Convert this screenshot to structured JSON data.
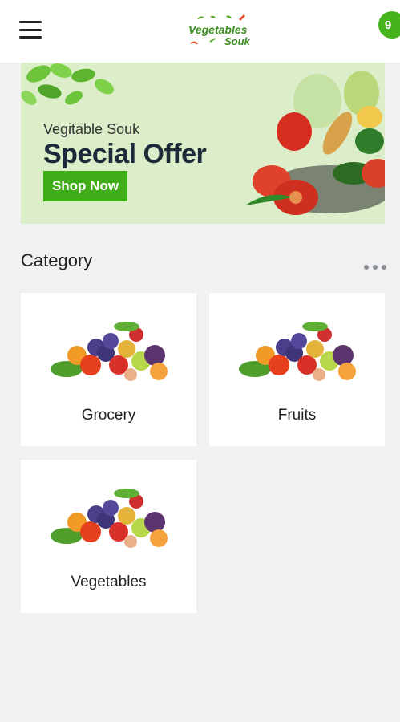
{
  "header": {
    "logo_line1": "Vegetables",
    "logo_line2": "Souk",
    "cart_count": "9"
  },
  "banner": {
    "subtitle": "Vegitable Souk",
    "title": "Special Offer",
    "button": "Shop Now"
  },
  "category": {
    "title": "Category",
    "items": [
      {
        "label": "Grocery"
      },
      {
        "label": "Fruits"
      },
      {
        "label": "Vegetables"
      }
    ]
  },
  "colors": {
    "accent": "#3fae19",
    "banner_bg": "#dcedc9",
    "page_bg": "#f1f1f2"
  }
}
